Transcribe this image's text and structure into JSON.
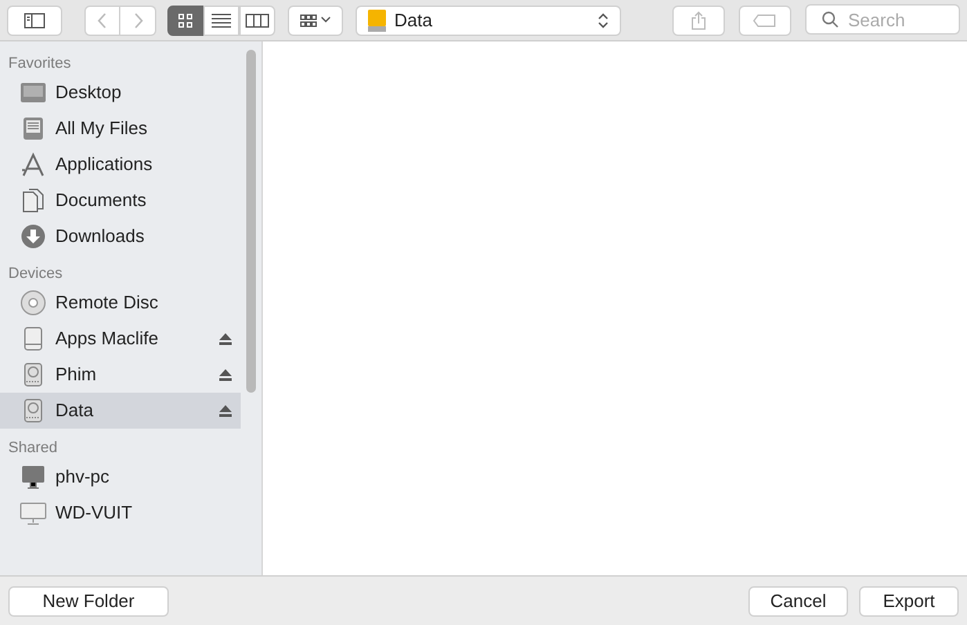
{
  "toolbar": {
    "view_modes": [
      {
        "kind": "icons",
        "selected": true
      },
      {
        "kind": "list",
        "selected": false
      },
      {
        "kind": "columns",
        "selected": false
      }
    ],
    "location": "Data",
    "search": {
      "placeholder": "Search"
    }
  },
  "sidebar": {
    "sections": [
      {
        "title": "Favorites",
        "items": [
          {
            "label": "Desktop",
            "kind": "desktop",
            "ejectable": false,
            "selected": false
          },
          {
            "label": "All My Files",
            "kind": "files",
            "ejectable": false,
            "selected": false
          },
          {
            "label": "Applications",
            "kind": "apps",
            "ejectable": false,
            "selected": false
          },
          {
            "label": "Documents",
            "kind": "documents",
            "ejectable": false,
            "selected": false
          },
          {
            "label": "Downloads",
            "kind": "downloads",
            "ejectable": false,
            "selected": false
          }
        ]
      },
      {
        "title": "Devices",
        "items": [
          {
            "label": "Remote Disc",
            "kind": "disc",
            "ejectable": false,
            "selected": false
          },
          {
            "label": "Apps Maclife",
            "kind": "drive",
            "ejectable": true,
            "selected": false
          },
          {
            "label": "Phim",
            "kind": "disk",
            "ejectable": true,
            "selected": false
          },
          {
            "label": "Data",
            "kind": "disk",
            "ejectable": true,
            "selected": true
          }
        ]
      },
      {
        "title": "Shared",
        "items": [
          {
            "label": "phv-pc",
            "kind": "pc",
            "ejectable": false,
            "selected": false
          },
          {
            "label": "WD-VUIT",
            "kind": "display",
            "ejectable": false,
            "selected": false
          }
        ]
      }
    ]
  },
  "buttons": {
    "new_folder": "New Folder",
    "cancel": "Cancel",
    "export": "Export"
  }
}
